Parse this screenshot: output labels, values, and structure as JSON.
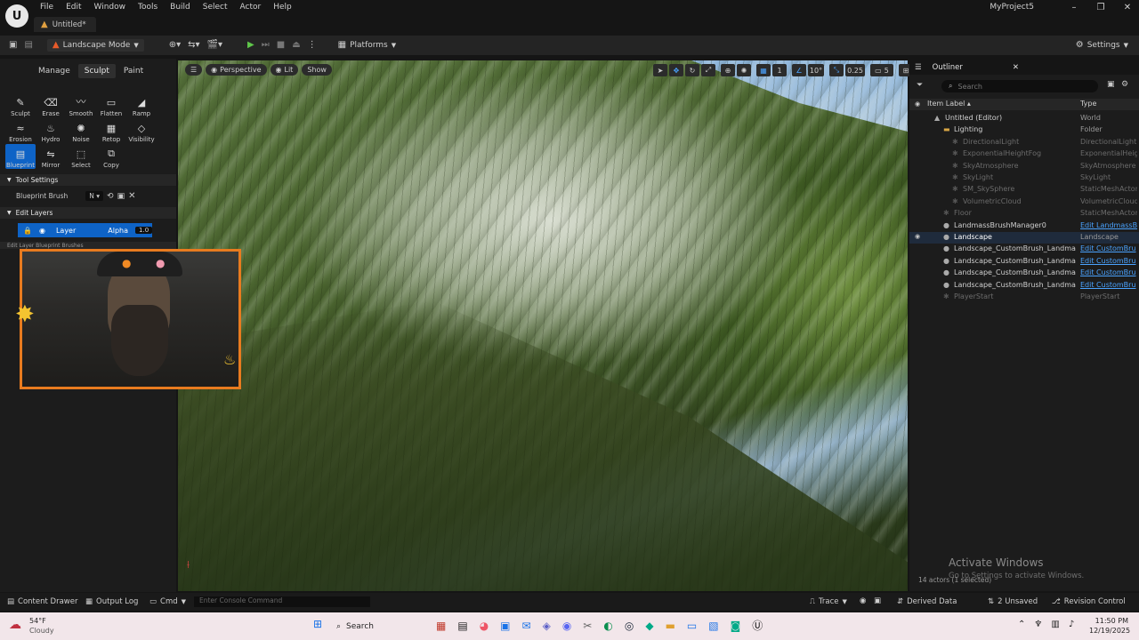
{
  "app": {
    "project": "MyProject5",
    "document_tab": "Untitled*",
    "menus": [
      "File",
      "Edit",
      "Window",
      "Tools",
      "Build",
      "Select",
      "Actor",
      "Help"
    ]
  },
  "toolbar": {
    "mode": "Landscape Mode",
    "platforms": "Platforms",
    "settings": "Settings"
  },
  "landscape_panel": {
    "tabs": [
      "Manage",
      "Sculpt",
      "Paint"
    ],
    "active_tab": "Sculpt",
    "tools": [
      {
        "label": "Sculpt",
        "icon": "✎"
      },
      {
        "label": "Erase",
        "icon": "⌫"
      },
      {
        "label": "Smooth",
        "icon": "〰"
      },
      {
        "label": "Flatten",
        "icon": "▭"
      },
      {
        "label": "Ramp",
        "icon": "◢"
      },
      {
        "label": "Erosion",
        "icon": "≈"
      },
      {
        "label": "Hydro",
        "icon": "♨"
      },
      {
        "label": "Noise",
        "icon": "✺"
      },
      {
        "label": "Retop",
        "icon": "▦"
      },
      {
        "label": "Visibility",
        "icon": "◇"
      },
      {
        "label": "Blueprint",
        "icon": "▤"
      },
      {
        "label": "Mirror",
        "icon": "⇋"
      },
      {
        "label": "Select",
        "icon": "⬚"
      },
      {
        "label": "Copy",
        "icon": "⧉"
      }
    ],
    "active_tool": "Blueprint",
    "tool_settings_header": "Tool Settings",
    "blueprint_brush_label": "Blueprint Brush",
    "blueprint_brush_value": "N",
    "edit_layers_header": "Edit Layers",
    "layer_name": "Layer",
    "layer_alpha_label": "Alpha",
    "layer_alpha_value": "1.0",
    "edit_layer_bp_brushes": "Edit Layer Blueprint Brushes"
  },
  "viewport": {
    "perspective": "Perspective",
    "lit": "Lit",
    "show": "Show",
    "rot_snap": "10°",
    "scale_snap": "0.25",
    "cam_speed": "5"
  },
  "outliner": {
    "title": "Outliner",
    "search_placeholder": "Search",
    "col_label": "Item Label",
    "col_type": "Type",
    "rows": [
      {
        "label": "Untitled (Editor)",
        "type": "World",
        "indent": 1,
        "dim": false,
        "link": false
      },
      {
        "label": "Lighting",
        "type": "Folder",
        "indent": 2,
        "dim": false,
        "link": false
      },
      {
        "label": "DirectionalLight",
        "type": "DirectionalLight",
        "indent": 3,
        "dim": true,
        "link": false
      },
      {
        "label": "ExponentialHeightFog",
        "type": "ExponentialHeightF",
        "indent": 3,
        "dim": true,
        "link": false
      },
      {
        "label": "SkyAtmosphere",
        "type": "SkyAtmosphere",
        "indent": 3,
        "dim": true,
        "link": false
      },
      {
        "label": "SkyLight",
        "type": "SkyLight",
        "indent": 3,
        "dim": true,
        "link": false
      },
      {
        "label": "SM_SkySphere",
        "type": "StaticMeshActor",
        "indent": 3,
        "dim": true,
        "link": false
      },
      {
        "label": "VolumetricCloud",
        "type": "VolumetricCloud",
        "indent": 3,
        "dim": true,
        "link": false
      },
      {
        "label": "Floor",
        "type": "StaticMeshActor",
        "indent": 2,
        "dim": true,
        "link": false
      },
      {
        "label": "LandmassBrushManager0",
        "type": "Edit LandmassB",
        "indent": 2,
        "dim": false,
        "link": true
      },
      {
        "label": "Landscape",
        "type": "Landscape",
        "indent": 2,
        "dim": false,
        "link": false,
        "selected": true
      },
      {
        "label": "Landscape_CustomBrush_Landma",
        "type": "Edit CustomBru",
        "indent": 2,
        "dim": false,
        "link": true
      },
      {
        "label": "Landscape_CustomBrush_Landma",
        "type": "Edit CustomBru",
        "indent": 2,
        "dim": false,
        "link": true
      },
      {
        "label": "Landscape_CustomBrush_Landma",
        "type": "Edit CustomBru",
        "indent": 2,
        "dim": false,
        "link": true
      },
      {
        "label": "Landscape_CustomBrush_Landma",
        "type": "Edit CustomBru",
        "indent": 2,
        "dim": false,
        "link": true
      },
      {
        "label": "PlayerStart",
        "type": "PlayerStart",
        "indent": 2,
        "dim": true,
        "link": false
      }
    ],
    "actor_count": "14 actors (1 selected)"
  },
  "watermark": {
    "title": "Activate Windows",
    "subtitle": "Go to Settings to activate Windows."
  },
  "statusbar": {
    "content_drawer": "Content Drawer",
    "output_log": "Output Log",
    "cmd": "Cmd",
    "console_placeholder": "Enter Console Command",
    "trace": "Trace",
    "derived_data": "Derived Data",
    "unsaved": "2 Unsaved",
    "revision_control": "Revision Control"
  },
  "taskbar": {
    "temperature": "54°F",
    "weather": "Cloudy",
    "search": "Search",
    "time": "11:50 PM",
    "date": "12/19/2025"
  },
  "colors": {
    "accent_blue": "#0e63c6",
    "webcam_border": "#e87b1f",
    "link": "#4aa3ff"
  }
}
